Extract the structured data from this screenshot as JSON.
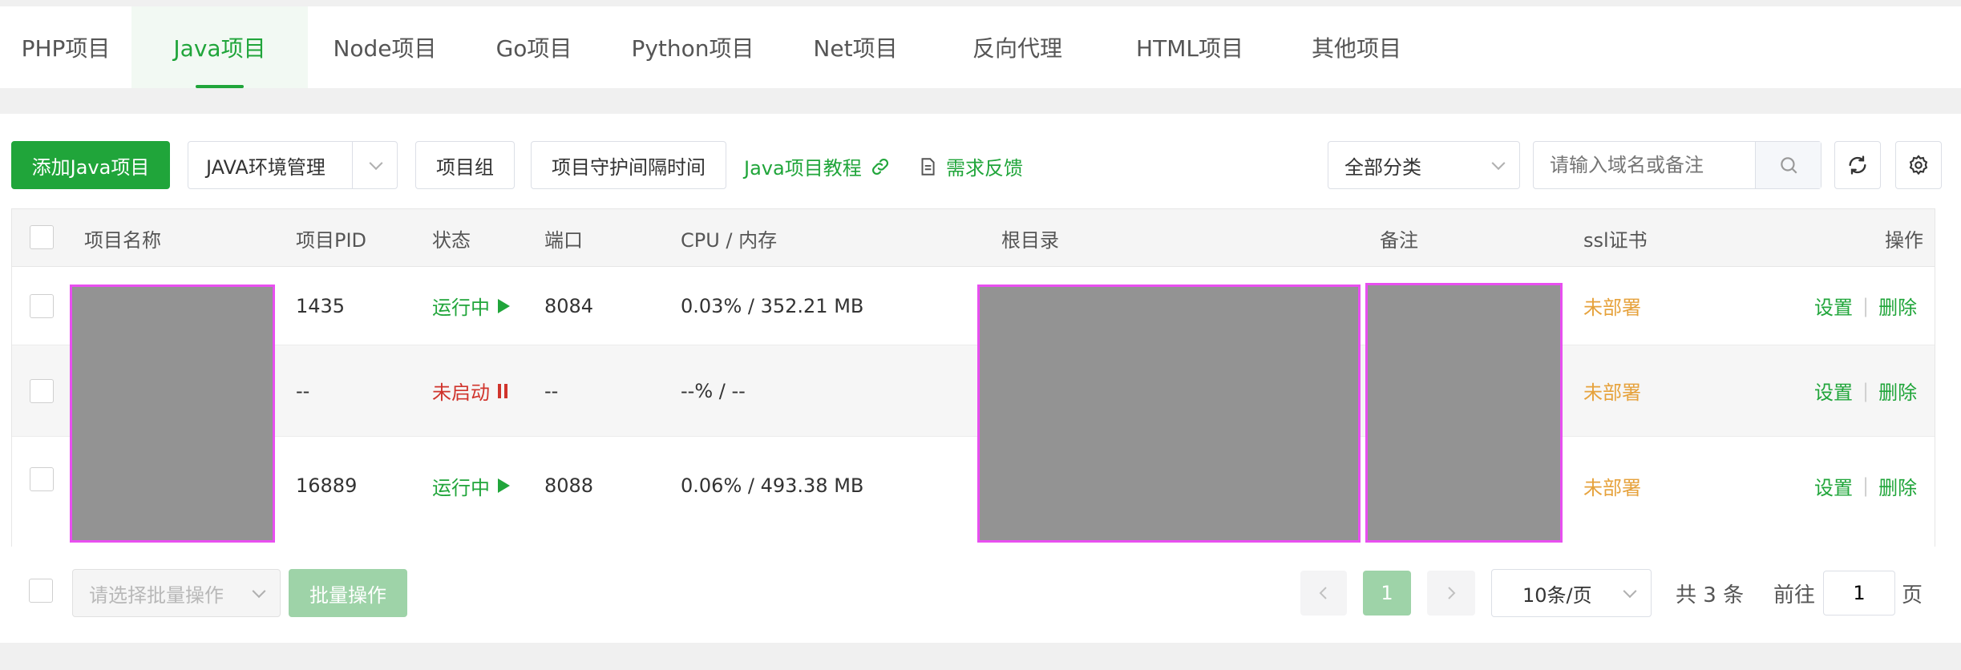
{
  "tabs": [
    {
      "label": "PHP项目"
    },
    {
      "label": "Java项目"
    },
    {
      "label": "Node项目"
    },
    {
      "label": "Go项目"
    },
    {
      "label": "Python项目"
    },
    {
      "label": "Net项目"
    },
    {
      "label": "反向代理"
    },
    {
      "label": "HTML项目"
    },
    {
      "label": "其他项目"
    }
  ],
  "toolbar": {
    "add_label": "添加Java项目",
    "env_label": "JAVA环境管理",
    "group_label": "项目组",
    "guard_label": "项目守护间隔时间",
    "tutorial_label": "Java项目教程",
    "feedback_label": "需求反馈",
    "category_value": "全部分类",
    "search_placeholder": "请输入域名或备注"
  },
  "table": {
    "headers": {
      "name": "项目名称",
      "pid": "项目PID",
      "status": "状态",
      "port": "端口",
      "cpu_mem": "CPU / 内存",
      "root": "根目录",
      "note": "备注",
      "ssl": "ssl证书",
      "action": "操作"
    },
    "rows": [
      {
        "pid": "1435",
        "status": "运行中",
        "status_icon": "play-icon",
        "port": "8084",
        "cpu_mem": "0.03% / 352.21 MB",
        "ssl": "未部署",
        "settings": "设置",
        "delete": "删除"
      },
      {
        "pid": "--",
        "status": "未启动",
        "status_icon": "pause-icon",
        "port": "--",
        "cpu_mem": "--% / --",
        "ssl": "未部署",
        "settings": "设置",
        "delete": "删除"
      },
      {
        "pid": "16889",
        "status": "运行中",
        "status_icon": "play-icon",
        "port": "8088",
        "cpu_mem": "0.06% / 493.38 MB",
        "ssl": "未部署",
        "settings": "设置",
        "delete": "删除"
      }
    ]
  },
  "footer": {
    "batch_placeholder": "请选择批量操作",
    "batch_button": "批量操作",
    "current_page": "1",
    "page_size": "10条/页",
    "total": "共 3 条",
    "goto_label": "前往",
    "goto_value": "1",
    "page_unit": "页"
  },
  "colors": {
    "accent": "#20a53a",
    "stopped": "#d0342c",
    "ssl_warning": "#e6a23c"
  }
}
